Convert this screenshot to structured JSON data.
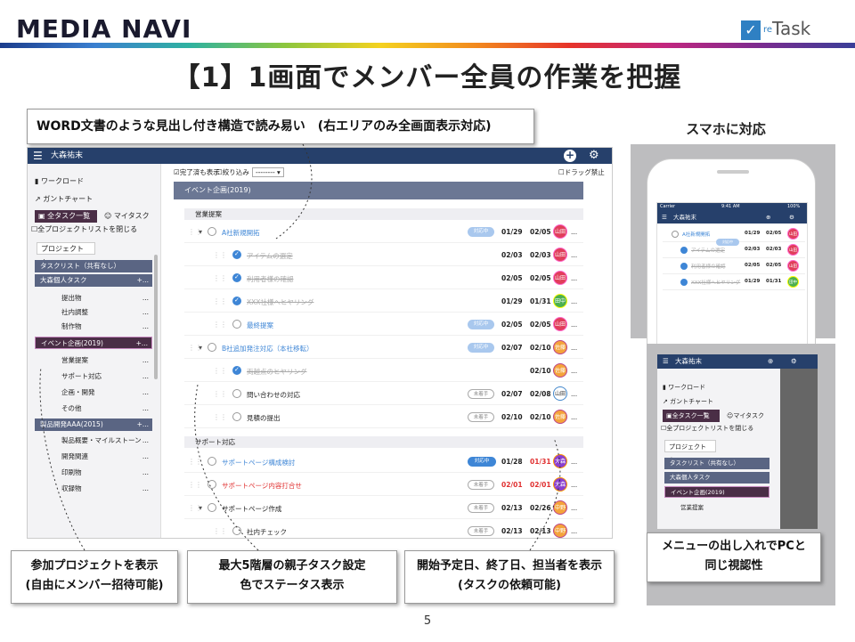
{
  "brand": "MEDIA NAVI",
  "retask": {
    "check": "✓",
    "prefix": "re",
    "name": "Task"
  },
  "title": "【1】1画面でメンバー全員の作業を把握",
  "callouts": {
    "word": "WORD文書のような見出し付き構造で読み易い　(右エリアのみ全画面表示対応)",
    "project_l1": "参加プロジェクトを表示",
    "project_l2": "(自由にメンバー招待可能)",
    "tasks_l1": "最大5階層の親子タスク設定",
    "tasks_l2": "色でステータス表示",
    "dates_l1": "開始予定日、終了日、担当者を表示",
    "dates_l2": "(タスクの依頼可能)",
    "menu_l1": "メニューの出し入れでPCと",
    "menu_l2": "同じ視認性"
  },
  "smartphone_label": "スマホに対応",
  "page_number": "5",
  "app": {
    "user": "大森祐末",
    "menu_icon": "☰",
    "add_icon": "+",
    "gear_icon": "⚙",
    "sidebar": {
      "workload": "ワークロード",
      "gantt": "ガントチャート",
      "all_tasks": "全タスク一覧",
      "my_tasks": "マイタスク",
      "close_projects": "全プロジェクトリストを閉じる",
      "project_tab": "プロジェクト",
      "project_tab_add": "+",
      "projects": [
        {
          "label": "タスクリスト（共有なし）",
          "kind": "dark",
          "dots": ""
        },
        {
          "label": "大森個人タスク",
          "kind": "dark",
          "dots": "+..."
        },
        {
          "label": "提出物",
          "kind": "sub",
          "dots": "..."
        },
        {
          "label": "社内調整",
          "kind": "sub",
          "dots": "..."
        },
        {
          "label": "制作物",
          "kind": "sub",
          "dots": "..."
        },
        {
          "label": "イベント企画(2019)",
          "kind": "maroon",
          "dots": "+..."
        },
        {
          "label": "営業提案",
          "kind": "sub",
          "dots": "..."
        },
        {
          "label": "サポート対応",
          "kind": "sub",
          "dots": "..."
        },
        {
          "label": "企画・開発",
          "kind": "sub",
          "dots": "..."
        },
        {
          "label": "その他",
          "kind": "sub",
          "dots": "..."
        },
        {
          "label": "製品開発AAA(2015)",
          "kind": "dark",
          "dots": "+..."
        },
        {
          "label": "製品概要・マイルストーン",
          "kind": "sub",
          "dots": "..."
        },
        {
          "label": "開発関連",
          "kind": "sub",
          "dots": "..."
        },
        {
          "label": "印刷物",
          "kind": "sub",
          "dots": "..."
        },
        {
          "label": "収録物",
          "kind": "sub",
          "dots": "..."
        }
      ]
    },
    "filters": {
      "show_done": "完了済も表示",
      "narrow": "絞り込み",
      "narrow_value": "--------",
      "no_drag": "ドラッグ禁止"
    },
    "event_header": "イベント企画(2019)",
    "sections": [
      "営業提案",
      "サポート対応"
    ],
    "tasks": [
      {
        "name": "A社新規開拓",
        "style": "link",
        "done": false,
        "status": "対応中",
        "stype": "act",
        "d1": "01/29",
        "d2": "02/05",
        "d1red": false,
        "d2red": false,
        "av": "山田",
        "avc": "av-r",
        "indent": 0,
        "caret": "▾"
      },
      {
        "name": "アイテムの選定",
        "style": "strike",
        "done": true,
        "status": "",
        "stype": "",
        "d1": "02/03",
        "d2": "02/03",
        "d1red": false,
        "d2red": false,
        "av": "山田",
        "avc": "av-r",
        "indent": 1,
        "caret": ""
      },
      {
        "name": "利用者様の確認",
        "style": "strike",
        "done": true,
        "status": "",
        "stype": "",
        "d1": "02/05",
        "d2": "02/05",
        "d1red": false,
        "d2red": false,
        "av": "山田",
        "avc": "av-r",
        "indent": 1,
        "caret": ""
      },
      {
        "name": "XXX社様へヒヤリング",
        "style": "strike",
        "done": true,
        "status": "",
        "stype": "",
        "d1": "01/29",
        "d2": "01/31",
        "d1red": false,
        "d2red": false,
        "av": "田中",
        "avc": "av-g",
        "indent": 1,
        "caret": ""
      },
      {
        "name": "最終提案",
        "style": "link",
        "done": false,
        "status": "対応中",
        "stype": "act",
        "d1": "02/05",
        "d2": "02/05",
        "d1red": false,
        "d2red": false,
        "av": "山田",
        "avc": "av-r",
        "indent": 1,
        "caret": ""
      },
      {
        "name": "B社追加発注対応（本社移転）",
        "style": "link",
        "done": false,
        "status": "対応中",
        "stype": "act",
        "d1": "02/07",
        "d2": "02/10",
        "d1red": false,
        "d2red": false,
        "av": "佐藤",
        "avc": "av-o",
        "indent": 0,
        "caret": "▾"
      },
      {
        "name": "両越点のヒヤリング",
        "style": "strike",
        "done": true,
        "status": "",
        "stype": "",
        "d1": "",
        "d2": "02/10",
        "d1red": false,
        "d2red": false,
        "av": "佐藤",
        "avc": "av-o",
        "indent": 1,
        "caret": ""
      },
      {
        "name": "問い合わせの対応",
        "style": "plain",
        "done": false,
        "status": "未着手",
        "stype": "no",
        "d1": "02/07",
        "d2": "02/08",
        "d1red": false,
        "d2red": false,
        "av": "山田",
        "avc": "av-w",
        "indent": 1,
        "caret": ""
      },
      {
        "name": "見積の提出",
        "style": "plain",
        "done": false,
        "status": "未着手",
        "stype": "no",
        "d1": "02/10",
        "d2": "02/10",
        "d1red": false,
        "d2red": false,
        "av": "佐藤",
        "avc": "av-o",
        "indent": 1,
        "caret": ""
      },
      {
        "name": "サポートページ構成検討",
        "style": "link",
        "done": false,
        "status": "対応中",
        "stype": "tog",
        "d1": "01/28",
        "d2": "01/31",
        "d1red": false,
        "d2red": true,
        "av": "大森",
        "avc": "av-p",
        "indent": 0,
        "caret": ""
      },
      {
        "name": "サポートページ内容打合せ",
        "style": "red",
        "done": false,
        "status": "未着手",
        "stype": "no",
        "d1": "02/01",
        "d2": "02/01",
        "d1red": true,
        "d2red": true,
        "av": "大森",
        "avc": "av-p",
        "indent": 0,
        "caret": ""
      },
      {
        "name": "サポートページ作成",
        "style": "plain",
        "done": false,
        "status": "未着手",
        "stype": "no",
        "d1": "02/13",
        "d2": "02/26",
        "d1red": false,
        "d2red": false,
        "av": "中野",
        "avc": "av-o",
        "indent": 0,
        "caret": "▾"
      },
      {
        "name": "社内チェック",
        "style": "plain",
        "done": false,
        "status": "未着手",
        "stype": "no",
        "d1": "02/13",
        "d2": "02/13",
        "d1red": false,
        "d2red": false,
        "av": "中野",
        "avc": "av-o",
        "indent": 1,
        "caret": ""
      }
    ]
  },
  "phone": {
    "carrier": "Carrier",
    "time": "9:41 AM",
    "battery": "100%",
    "user": "大森祐末",
    "rows": [
      {
        "name": "A社新規開拓",
        "style": "link",
        "done": false,
        "status": "対応中",
        "d1": "01/29",
        "d2": "02/05",
        "av": "山田",
        "avc": "av-r"
      },
      {
        "name": "アイテムの選定",
        "style": "strike",
        "done": true,
        "status": "",
        "d1": "02/03",
        "d2": "02/03",
        "av": "山田",
        "avc": "av-r"
      },
      {
        "name": "利用者様の確認",
        "style": "strike",
        "done": true,
        "status": "",
        "d1": "02/05",
        "d2": "02/05",
        "av": "山田",
        "avc": "av-r"
      },
      {
        "name": "XXX社様へヒヤリング",
        "style": "strike",
        "done": true,
        "status": "",
        "d1": "01/29",
        "d2": "01/31",
        "av": "田中",
        "avc": "av-g"
      }
    ]
  },
  "app2": {
    "user": "大森祐末",
    "workload": "ワークロード",
    "gantt": "ガントチャート",
    "all_tasks": "全タスク一覧",
    "my_tasks": "マイタスク",
    "close_projects": "全プロジェクトリストを閉じる",
    "project_tab": "プロジェクト",
    "projects": [
      {
        "label": "タスクリスト（共有なし）",
        "kind": "dark"
      },
      {
        "label": "大森個人タスク",
        "kind": "dark"
      },
      {
        "label": "イベント企画(2019)",
        "kind": "maroon"
      },
      {
        "label": "営業提案",
        "kind": "sub"
      }
    ]
  }
}
